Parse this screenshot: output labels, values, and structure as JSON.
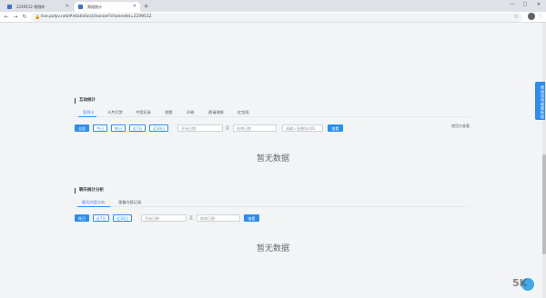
{
  "browser": {
    "tabs": [
      {
        "title": "2249512-视频库"
      },
      {
        "title": "频道统计"
      }
    ],
    "new_tab": "+",
    "url": "live.polyv.net/#/statistics/channel?channelId=2249512",
    "window_controls": [
      "—",
      "□",
      "✕"
    ]
  },
  "interaction_section": {
    "title": "互动统计",
    "tabs": [
      "签到卡",
      "卡片打赏",
      "中奖纪录",
      "答题",
      "问卷",
      "邀请海报",
      "红包雨"
    ],
    "date_buttons": [
      "全部",
      "今日",
      "昨日",
      "近7日",
      "近30日"
    ],
    "start_placeholder": "开始日期",
    "range_sep": "至",
    "end_placeholder": "结束日期",
    "search_placeholder": "请输入直播场次ID",
    "query_label": "查看",
    "hint": "使用方查看",
    "empty_text": "暂无数据"
  },
  "chat_section": {
    "title": "聊天统计分析",
    "tabs": [
      "聊天内容分析",
      "观看内容记录"
    ],
    "date_buttons": [
      "昨日",
      "近7日",
      "近30日"
    ],
    "start_placeholder": "开始日期",
    "range_sep": "至",
    "end_placeholder": "结束日期",
    "query_label": "查看",
    "empty_text": "暂无数据"
  },
  "side_float": {
    "label": "使用保利威最新版"
  },
  "colors": {
    "accent": "#2d8cf0",
    "background": "#f3f4f6"
  }
}
